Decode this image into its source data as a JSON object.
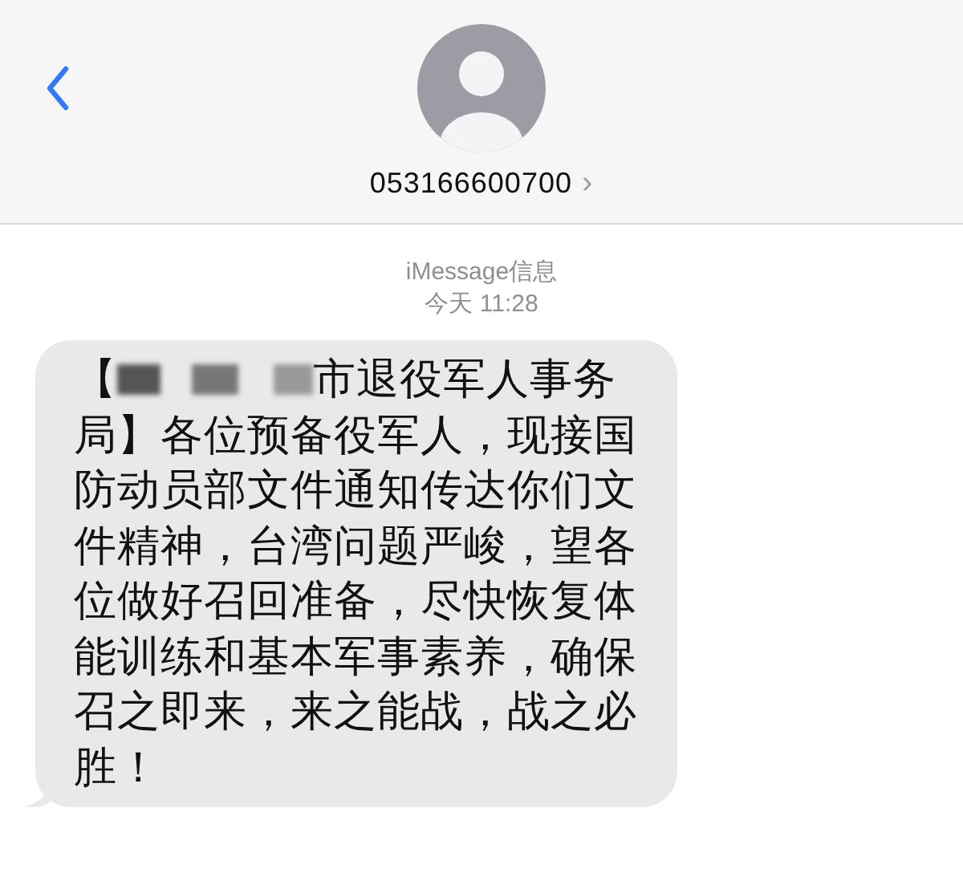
{
  "header": {
    "contact": "053166600700",
    "detail_chevron": "›"
  },
  "conversation": {
    "service": "iMessage信息",
    "timestamp": "今天 11:28"
  },
  "messages": [
    {
      "kind": "incoming",
      "prefix": "【",
      "redacted": true,
      "lead": "市退役军人事务",
      "text": "局】各位预备役军人，现接国防动员部文件通知传达你们文件精神，台湾问题严峻，望各位做好召回准备，尽快恢复体能训练和基本军事素养，确保召之即来，来之能战，战之必胜！"
    }
  ]
}
